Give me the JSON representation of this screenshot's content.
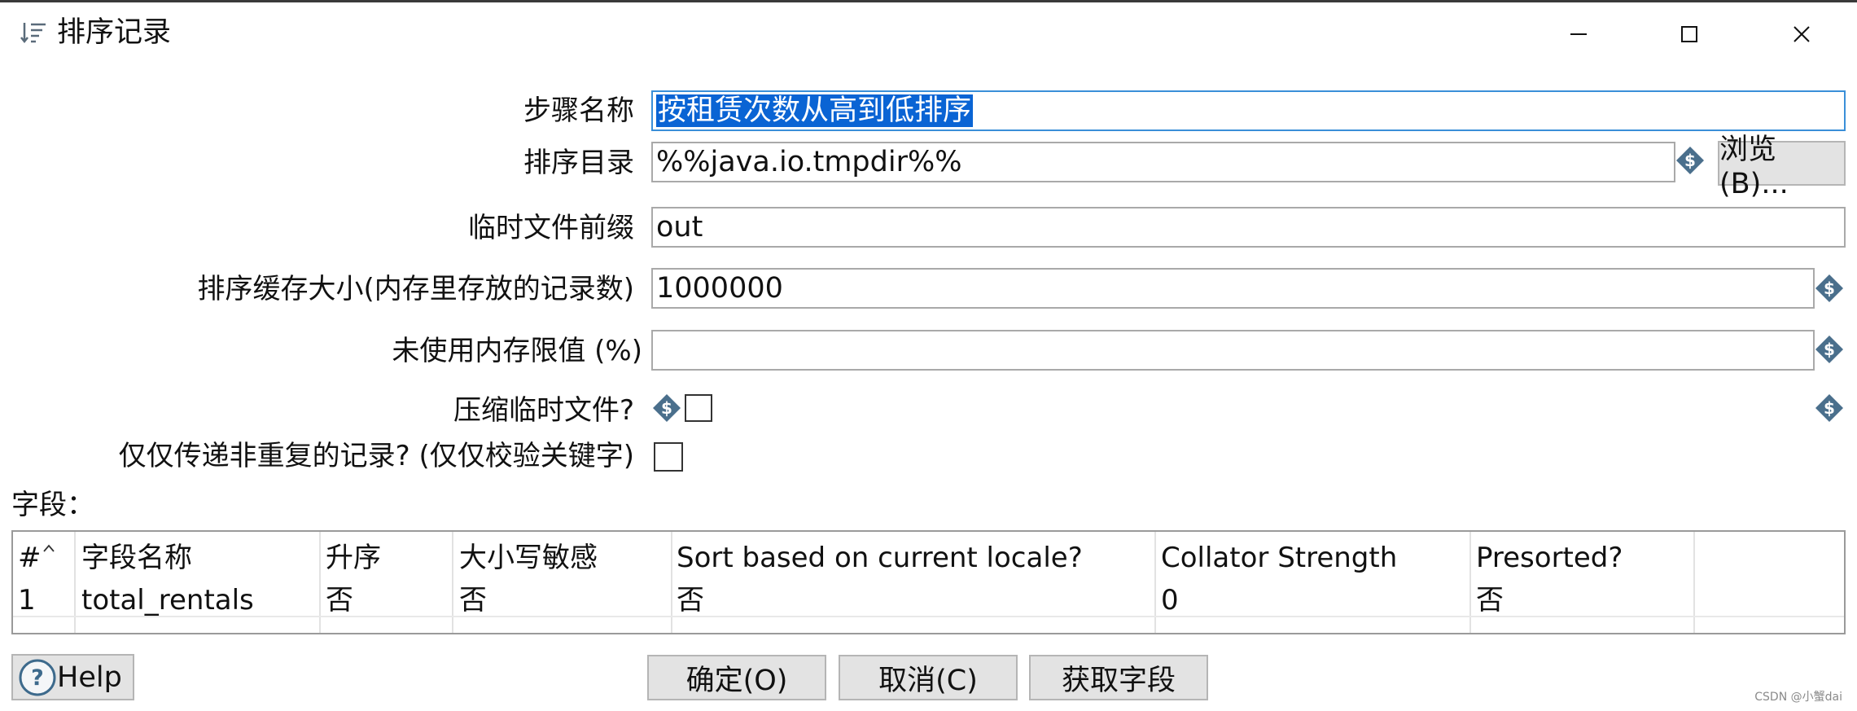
{
  "window": {
    "title": "排序记录",
    "title_icon": "sort-rows-icon",
    "controls": [
      "minimize-icon",
      "maximize-icon",
      "close-icon"
    ]
  },
  "form": {
    "step_name_label": "步骤名称",
    "step_name_value": "按租赁次数从高到低排序",
    "sort_dir_label": "排序目录",
    "sort_dir_value": "%%java.io.tmpdir%%",
    "browse_button": "浏览(B)...",
    "temp_prefix_label": "临时文件前缀",
    "temp_prefix_value": "out",
    "sort_size_label": "排序缓存大小(内存里存放的记录数)",
    "sort_size_value": "1000000",
    "free_memory_label": "未使用内存限值 (%)",
    "free_memory_value": "",
    "compress_label": "压缩临时文件?",
    "compress_checked": false,
    "unique_label": "仅仅传递非重复的记录? (仅仅校验关键字)",
    "unique_checked": false
  },
  "fields": {
    "label": "字段：",
    "columns": [
      "#",
      "字段名称",
      "升序",
      "大小写敏感",
      "Sort based on current locale?",
      "Collator Strength",
      "Presorted?"
    ],
    "rows": [
      [
        "1",
        "total_rentals",
        "否",
        "否",
        "否",
        "0",
        "否"
      ]
    ]
  },
  "buttons": {
    "help": "Help",
    "ok": "确定(O)",
    "cancel": "取消(C)",
    "get_fields": "获取字段"
  },
  "watermark": "CSDN @小蟹dai",
  "colors": {
    "selection": "#0a64d4",
    "focus_border": "#3a8fd8",
    "variable_icon": "#4a6f8c",
    "button_bg": "#e3e3e3"
  }
}
